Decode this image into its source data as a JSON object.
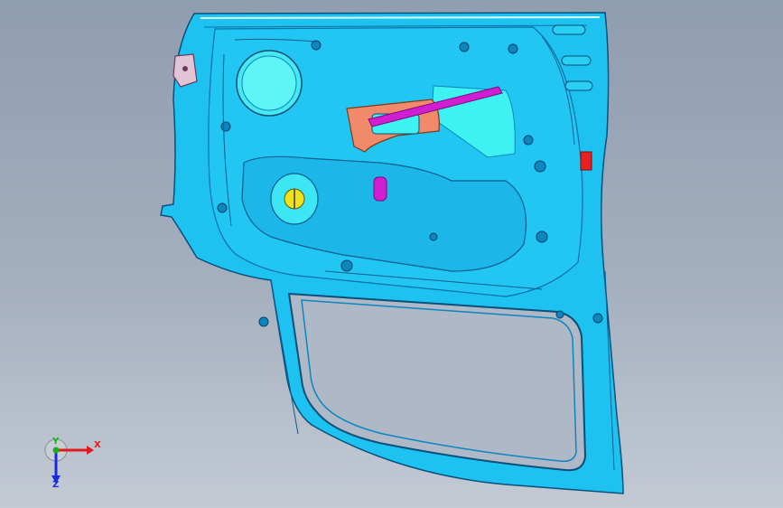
{
  "viewport": {
    "background_top": "#8f9db0",
    "background_bottom": "#c3cad4"
  },
  "model": {
    "icon": "car-door-inner-panel-icon",
    "colors": {
      "panel": "#1ec2f0",
      "panel_dark": "#0b86bf",
      "edge": "#0a4f7a",
      "cyan_face": "#3ff2f2",
      "bracket": "#f08a6a",
      "magenta": "#d21ed2",
      "hinge": "#e3c4d6",
      "marker_red": "#e82020",
      "marker_yellow": "#f0e21a"
    }
  },
  "triad": {
    "x_label": "X",
    "y_label": "Y",
    "z_label": "Z",
    "colors": {
      "x": "#e01a1a",
      "y": "#1ab01a",
      "z": "#1a2ae0"
    }
  }
}
